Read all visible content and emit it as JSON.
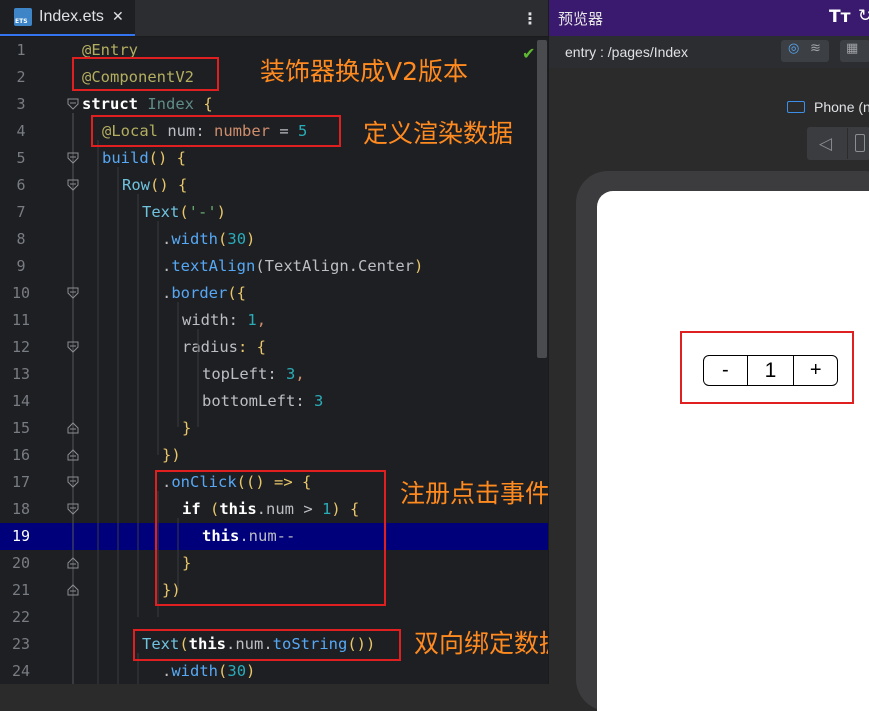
{
  "editor": {
    "tab_title": "Index.ets",
    "tab_close": "✕",
    "file_icon_label": "ETS",
    "more_icon": "⋮",
    "check_icon": "✔",
    "lines": [
      {
        "n": "1"
      },
      {
        "n": "2"
      },
      {
        "n": "3"
      },
      {
        "n": "4"
      },
      {
        "n": "5"
      },
      {
        "n": "6"
      },
      {
        "n": "7"
      },
      {
        "n": "8"
      },
      {
        "n": "9"
      },
      {
        "n": "10"
      },
      {
        "n": "11"
      },
      {
        "n": "12"
      },
      {
        "n": "13"
      },
      {
        "n": "14"
      },
      {
        "n": "15"
      },
      {
        "n": "16"
      },
      {
        "n": "17"
      },
      {
        "n": "18"
      },
      {
        "n": "19"
      },
      {
        "n": "20"
      },
      {
        "n": "21"
      },
      {
        "n": "22"
      },
      {
        "n": "23"
      },
      {
        "n": "24"
      }
    ],
    "highlighted_line": "19",
    "code": {
      "l1": {
        "a": "@Entry"
      },
      "l2": {
        "a": "@ComponentV2"
      },
      "l3": {
        "a": "struct",
        "b": " Index ",
        "c": "{"
      },
      "l4": {
        "a": "@Local",
        "b": " num",
        "c": ": ",
        "d": "number",
        "e": " = ",
        "f": "5"
      },
      "l5": {
        "a": "build",
        "b": "() {"
      },
      "l6": {
        "a": "Row",
        "b": "() {"
      },
      "l7": {
        "a": "Text",
        "b": "(",
        "c": "'-'",
        "d": ")"
      },
      "l8": {
        "a": ".",
        "b": "width",
        "c": "(",
        "d": "30",
        "e": ")"
      },
      "l9": {
        "a": ".",
        "b": "textAlign",
        "c": "(TextAlign.",
        "d": "Center",
        "e": ")"
      },
      "l10": {
        "a": ".",
        "b": "border",
        "c": "({"
      },
      "l11": {
        "a": "width",
        "b": ": ",
        "c": "1",
        "d": ","
      },
      "l12": {
        "a": "radius",
        "b": ": {"
      },
      "l13": {
        "a": "topLeft",
        "b": ": ",
        "c": "3",
        "d": ","
      },
      "l14": {
        "a": "bottomLeft",
        "b": ": ",
        "c": "3"
      },
      "l15": {
        "a": "}"
      },
      "l16": {
        "a": "})"
      },
      "l17": {
        "a": ".",
        "b": "onClick",
        "c": "(() => {"
      },
      "l18": {
        "a": "if",
        "b": " (",
        "c": "this",
        "d": ".num > ",
        "e": "1",
        "f": ") {"
      },
      "l19": {
        "a": "this",
        "b": ".num--"
      },
      "l20": {
        "a": "}"
      },
      "l21": {
        "a": "})"
      },
      "l22": {
        "a": ""
      },
      "l23": {
        "a": "Text",
        "b": "(",
        "c": "this",
        "d": ".num.",
        "e": "toString",
        "f": "())"
      },
      "l24": {
        "a": ".",
        "b": "width",
        "c": "(",
        "d": "30",
        "e": ")"
      }
    }
  },
  "annotations": {
    "decorator": "装饰器换成V2版本",
    "define": "定义渲染数据",
    "register": "注册点击事件",
    "bind": "双向绑定数据"
  },
  "previewer": {
    "title": "预览器",
    "font_icon": "Tт",
    "rotate_icon": "↻",
    "path": "entry : /pages/Index",
    "inspect_icon": "◎",
    "layers_icon": "≋",
    "grid_icon": "▦",
    "device_label": "Phone (n",
    "back_icon": "◁",
    "counter": {
      "minus": "-",
      "value": "1",
      "plus": "+"
    }
  },
  "colors": {
    "editor_bg": "#1e1f22",
    "highlight_line": "#00007a",
    "annotation_box": "#e02020",
    "annotation_text": "#ff8a1f",
    "previewer_header": "#3a1a6e"
  }
}
